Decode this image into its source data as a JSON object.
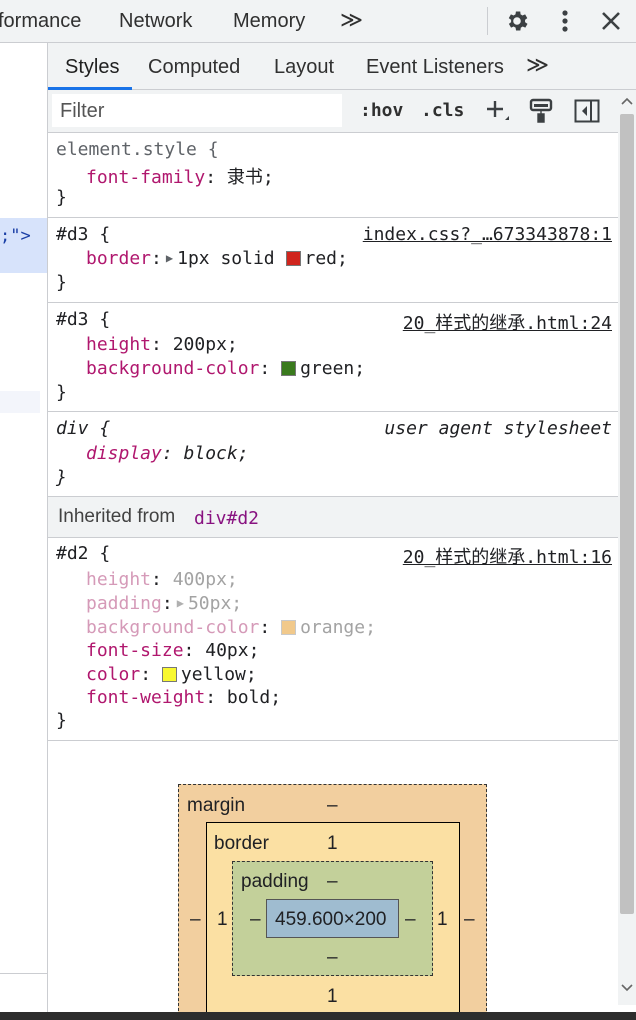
{
  "toolbar": {
    "tabs": [
      "formance",
      "Network",
      "Memory"
    ],
    "more_tabs": "≫",
    "settings_icon": "gear-icon",
    "menu_icon": "kebab-icon",
    "close_icon": "close-icon"
  },
  "elements_panel": {
    "selected_fragment": ";\">"
  },
  "subtabs": [
    "Styles",
    "Computed",
    "Layout",
    "Event Listeners"
  ],
  "subtabs_more": "≫",
  "filter": {
    "placeholder": "Filter",
    "hov": ":hov",
    "cls": ".cls"
  },
  "rules": [
    {
      "selector": "element.style {",
      "source": "",
      "decls": [
        {
          "prop": "font-family",
          "value": "隶书;"
        }
      ],
      "close": "}"
    },
    {
      "selector": "#d3 {",
      "source": "index.css?_…673343878:1",
      "decls": [
        {
          "prop": "border",
          "value": "1px solid",
          "swatch_value": "red;",
          "color": "#d0251d"
        }
      ],
      "close": "}"
    },
    {
      "selector": "#d3 {",
      "source": "20_样式的继承.html:24",
      "decls": [
        {
          "prop": "height",
          "value": "200px;"
        },
        {
          "prop": "background-color",
          "swatch_value": "green;",
          "color": "#3a7a1d"
        }
      ],
      "close": "}"
    },
    {
      "selector": "div {",
      "source": "user agent stylesheet",
      "decls": [
        {
          "prop": "display",
          "value": "block;"
        }
      ],
      "close": "}"
    }
  ],
  "inherited": {
    "label": "Inherited from",
    "selector": "div#d2"
  },
  "inherited_rule": {
    "selector": "#d2 {",
    "source": "20_样式的继承.html:16",
    "decls": [
      {
        "prop": "height",
        "value": "400px;"
      },
      {
        "prop": "padding",
        "value": "50px;"
      },
      {
        "prop": "background-color",
        "swatch_value": "orange;",
        "color": "#f1c98b"
      },
      {
        "prop": "font-size",
        "value": "40px;"
      },
      {
        "prop": "color",
        "swatch_value": "yellow;",
        "color": "#f8f830"
      },
      {
        "prop": "font-weight",
        "value": "bold;"
      }
    ],
    "close": "}"
  },
  "boxmodel": {
    "margin_label": "margin",
    "margin_top": "–",
    "margin_left": "–",
    "margin_right": "–",
    "border_label": "border",
    "border_top": "1",
    "border_left": "1",
    "border_right": "1",
    "border_bottom": "1",
    "padding_label": "padding",
    "padding_top": "–",
    "padding_left": "–",
    "padding_right": "–",
    "padding_bottom": "–",
    "content": "459.600×200"
  },
  "colors": {
    "margin_bg": "#f2cf9f",
    "border_bg": "#fbe0a3",
    "padding_bg": "#c3d09a",
    "content_bg": "#9fbcd0"
  }
}
